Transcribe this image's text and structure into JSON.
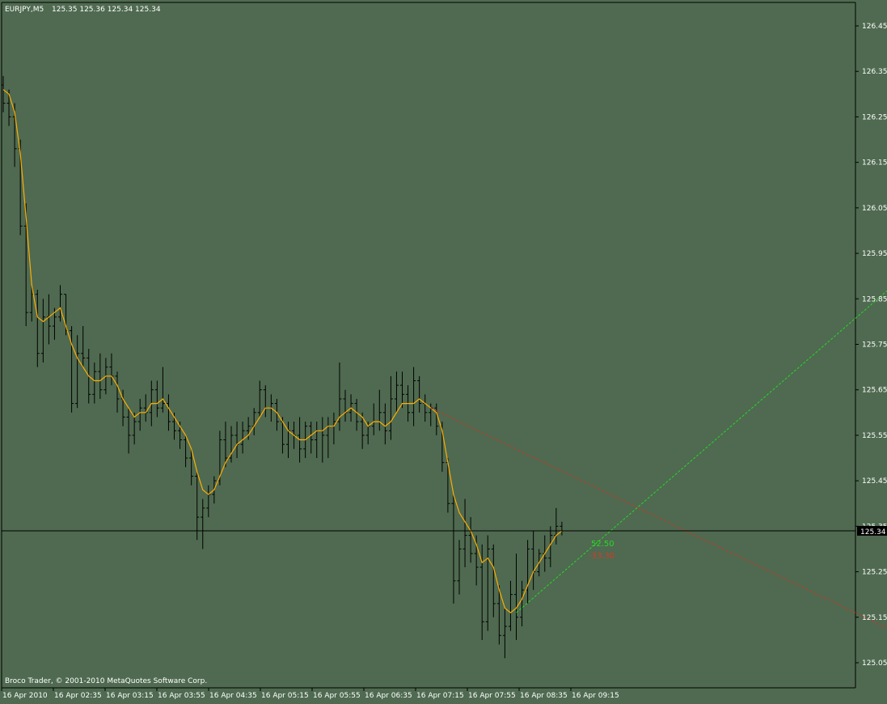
{
  "header": {
    "symbol": "EURJPY,M5",
    "quotes": "125.35 125.36 125.34 125.34"
  },
  "footer": {
    "copyright": "Broco Trader, © 2001-2010 MetaQuotes Software Corp."
  },
  "colors": {
    "background": "#4f6a50",
    "bars": "#000000",
    "moving_average": "#ffae00",
    "trend_up": "#27d827",
    "trend_down": "#c23a2a",
    "price_line": "#000000",
    "axis_text": "#ffffff"
  },
  "annotations": [
    {
      "text": "52.50",
      "color": "#27d827"
    },
    {
      "text": "-33.30",
      "color": "#d43a2a"
    }
  ],
  "chart_data": {
    "type": "ohlc",
    "title": "EURJPY,M5",
    "timeframe": "M5",
    "ylim": [
      125.0,
      126.5
    ],
    "y_ticks": [
      "126.45",
      "126.35",
      "126.25",
      "126.15",
      "126.05",
      "125.95",
      "125.85",
      "125.75",
      "125.65",
      "125.55",
      "125.45",
      "125.35",
      "125.25",
      "125.15",
      "125.05"
    ],
    "x_ticks": [
      "16 Apr 2010",
      "16 Apr 02:35",
      "16 Apr 03:15",
      "16 Apr 03:55",
      "16 Apr 04:35",
      "16 Apr 05:15",
      "16 Apr 05:55",
      "16 Apr 06:35",
      "16 Apr 07:15",
      "16 Apr 07:55",
      "16 Apr 08:35",
      "16 Apr 09:15"
    ],
    "current_price": 125.34,
    "current_price_label": "125.34",
    "series": [
      {
        "type": "ohlc",
        "data": [
          [
            126.32,
            126.34,
            126.26,
            126.28
          ],
          [
            126.28,
            126.31,
            126.23,
            126.25
          ],
          [
            126.25,
            126.28,
            126.14,
            126.18
          ],
          [
            126.18,
            126.2,
            125.99,
            126.01
          ],
          [
            126.01,
            126.06,
            125.79,
            125.82
          ],
          [
            125.82,
            125.88,
            125.8,
            125.86
          ],
          [
            125.86,
            125.87,
            125.7,
            125.73
          ],
          [
            125.73,
            125.85,
            125.71,
            125.81
          ],
          [
            125.81,
            125.86,
            125.75,
            125.79
          ],
          [
            125.79,
            125.83,
            125.76,
            125.81
          ],
          [
            125.81,
            125.88,
            125.8,
            125.86
          ],
          [
            125.86,
            125.86,
            125.77,
            125.78
          ],
          [
            125.78,
            125.79,
            125.6,
            125.62
          ],
          [
            125.62,
            125.77,
            125.61,
            125.73
          ],
          [
            125.73,
            125.79,
            125.7,
            125.72
          ],
          [
            125.72,
            125.74,
            125.62,
            125.64
          ],
          [
            125.64,
            125.71,
            125.62,
            125.69
          ],
          [
            125.69,
            125.73,
            125.63,
            125.65
          ],
          [
            125.65,
            125.72,
            125.64,
            125.7
          ],
          [
            125.7,
            125.73,
            125.66,
            125.68
          ],
          [
            125.68,
            125.69,
            125.6,
            125.63
          ],
          [
            125.63,
            125.65,
            125.57,
            125.59
          ],
          [
            125.59,
            125.61,
            125.51,
            125.55
          ],
          [
            125.55,
            125.6,
            125.53,
            125.58
          ],
          [
            125.58,
            125.63,
            125.56,
            125.61
          ],
          [
            125.61,
            125.64,
            125.58,
            125.6
          ],
          [
            125.6,
            125.67,
            125.57,
            125.65
          ],
          [
            125.65,
            125.67,
            125.59,
            125.61
          ],
          [
            125.61,
            125.7,
            125.6,
            125.62
          ],
          [
            125.62,
            125.64,
            125.56,
            125.58
          ],
          [
            125.58,
            125.6,
            125.54,
            125.56
          ],
          [
            125.56,
            125.58,
            125.52,
            125.54
          ],
          [
            125.54,
            125.55,
            125.48,
            125.5
          ],
          [
            125.5,
            125.52,
            125.44,
            125.46
          ],
          [
            125.46,
            125.47,
            125.32,
            125.37
          ],
          [
            125.37,
            125.41,
            125.3,
            125.39
          ],
          [
            125.39,
            125.44,
            125.37,
            125.42
          ],
          [
            125.42,
            125.46,
            125.4,
            125.45
          ],
          [
            125.45,
            125.56,
            125.44,
            125.54
          ],
          [
            125.54,
            125.58,
            125.48,
            125.5
          ],
          [
            125.5,
            125.57,
            125.49,
            125.55
          ],
          [
            125.55,
            125.58,
            125.5,
            125.53
          ],
          [
            125.53,
            125.58,
            125.51,
            125.56
          ],
          [
            125.56,
            125.59,
            125.54,
            125.57
          ],
          [
            125.57,
            125.61,
            125.55,
            125.6
          ],
          [
            125.6,
            125.67,
            125.59,
            125.65
          ],
          [
            125.65,
            125.66,
            125.59,
            125.61
          ],
          [
            125.61,
            125.64,
            125.58,
            125.62
          ],
          [
            125.62,
            125.63,
            125.56,
            125.58
          ],
          [
            125.58,
            125.59,
            125.51,
            125.53
          ],
          [
            125.53,
            125.58,
            125.5,
            125.56
          ],
          [
            125.56,
            125.58,
            125.52,
            125.55
          ],
          [
            125.55,
            125.59,
            125.49,
            125.52
          ],
          [
            125.52,
            125.58,
            125.5,
            125.57
          ],
          [
            125.57,
            125.58,
            125.51,
            125.54
          ],
          [
            125.54,
            125.58,
            125.5,
            125.56
          ],
          [
            125.56,
            125.59,
            125.49,
            125.55
          ],
          [
            125.55,
            125.59,
            125.5,
            125.57
          ],
          [
            125.57,
            125.6,
            125.53,
            125.58
          ],
          [
            125.58,
            125.71,
            125.56,
            125.63
          ],
          [
            125.63,
            125.65,
            125.58,
            125.6
          ],
          [
            125.6,
            125.64,
            125.58,
            125.62
          ],
          [
            125.62,
            125.63,
            125.56,
            125.58
          ],
          [
            125.58,
            125.6,
            125.52,
            125.55
          ],
          [
            125.55,
            125.58,
            125.53,
            125.57
          ],
          [
            125.57,
            125.62,
            125.55,
            125.58
          ],
          [
            125.58,
            125.65,
            125.56,
            125.6
          ],
          [
            125.6,
            125.62,
            125.53,
            125.56
          ],
          [
            125.56,
            125.68,
            125.54,
            125.63
          ],
          [
            125.63,
            125.69,
            125.6,
            125.66
          ],
          [
            125.66,
            125.69,
            125.61,
            125.64
          ],
          [
            125.64,
            125.66,
            125.58,
            125.6
          ],
          [
            125.6,
            125.7,
            125.57,
            125.67
          ],
          [
            125.67,
            125.68,
            125.6,
            125.62
          ],
          [
            125.62,
            125.64,
            125.58,
            125.6
          ],
          [
            125.6,
            125.62,
            125.57,
            125.61
          ],
          [
            125.61,
            125.62,
            125.55,
            125.57
          ],
          [
            125.57,
            125.58,
            125.47,
            125.49
          ],
          [
            125.49,
            125.5,
            125.38,
            125.4
          ],
          [
            125.4,
            125.42,
            125.18,
            125.23
          ],
          [
            125.23,
            125.32,
            125.2,
            125.3
          ],
          [
            125.3,
            125.41,
            125.26,
            125.33
          ],
          [
            125.33,
            125.37,
            125.27,
            125.29
          ],
          [
            125.29,
            125.33,
            125.22,
            125.26
          ],
          [
            125.26,
            125.31,
            125.1,
            125.14
          ],
          [
            125.14,
            125.33,
            125.12,
            125.3
          ],
          [
            125.3,
            125.31,
            125.15,
            125.18
          ],
          [
            125.18,
            125.22,
            125.09,
            125.11
          ],
          [
            125.11,
            125.17,
            125.06,
            125.13
          ],
          [
            125.13,
            125.23,
            125.12,
            125.2
          ],
          [
            125.2,
            125.29,
            125.1,
            125.15
          ],
          [
            125.15,
            125.23,
            125.13,
            125.21
          ],
          [
            125.21,
            125.32,
            125.18,
            125.3
          ],
          [
            125.3,
            125.34,
            125.21,
            125.25
          ],
          [
            125.25,
            125.3,
            125.24,
            125.29
          ],
          [
            125.29,
            125.33,
            125.25,
            125.28
          ],
          [
            125.28,
            125.35,
            125.26,
            125.33
          ],
          [
            125.33,
            125.39,
            125.31,
            125.35
          ],
          [
            125.35,
            125.36,
            125.33,
            125.34
          ]
        ]
      },
      {
        "type": "line",
        "data": [
          126.31,
          126.3,
          126.26,
          126.17,
          126.03,
          125.88,
          125.81,
          125.8,
          125.81,
          125.82,
          125.83,
          125.79,
          125.75,
          125.72,
          125.7,
          125.68,
          125.67,
          125.67,
          125.68,
          125.68,
          125.66,
          125.63,
          125.61,
          125.59,
          125.6,
          125.6,
          125.62,
          125.62,
          125.63,
          125.61,
          125.59,
          125.57,
          125.55,
          125.52,
          125.47,
          125.43,
          125.42,
          125.43,
          125.46,
          125.49,
          125.51,
          125.53,
          125.54,
          125.55,
          125.57,
          125.59,
          125.61,
          125.61,
          125.6,
          125.58,
          125.56,
          125.55,
          125.54,
          125.54,
          125.55,
          125.56,
          125.56,
          125.57,
          125.57,
          125.59,
          125.6,
          125.61,
          125.6,
          125.59,
          125.57,
          125.58,
          125.58,
          125.57,
          125.58,
          125.6,
          125.62,
          125.62,
          125.62,
          125.63,
          125.62,
          125.61,
          125.6,
          125.56,
          125.49,
          125.42,
          125.38,
          125.36,
          125.34,
          125.31,
          125.27,
          125.28,
          125.26,
          125.21,
          125.17,
          125.16,
          125.17,
          125.19,
          125.22,
          125.25,
          125.27,
          125.29,
          125.31,
          125.33,
          125.34
        ]
      },
      {
        "type": "trendline",
        "points": [
          [
            75,
            125.61
          ],
          [
            176,
            125.0
          ]
        ]
      },
      {
        "type": "trendline",
        "points": [
          [
            90,
            125.16
          ],
          [
            181,
            126.15
          ]
        ]
      }
    ]
  }
}
